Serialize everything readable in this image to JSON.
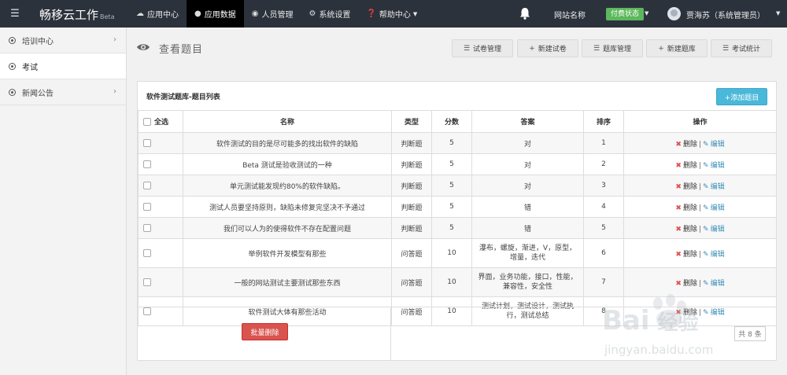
{
  "navbar": {
    "brand": "畅移云工作",
    "brand_suffix": "Beta",
    "items": [
      {
        "label": "应用中心",
        "icon": "cloud-icon"
      },
      {
        "label": "应用数据",
        "icon": "users-icon",
        "active": true
      },
      {
        "label": "人员管理",
        "icon": "dashboard-icon"
      },
      {
        "label": "系统设置",
        "icon": "gears-icon"
      },
      {
        "label": "帮助中心",
        "icon": "question-icon",
        "has_dropdown": true
      }
    ],
    "site_name": "网站名称",
    "pay_status": "付费状态",
    "user": "贾海苏（系统管理员）"
  },
  "sidebar": {
    "items": [
      {
        "label": "培训中心",
        "has_arrow": true
      },
      {
        "label": "考试",
        "active": true
      },
      {
        "label": "新闻公告",
        "has_arrow": true
      }
    ]
  },
  "page": {
    "title": "查看题目",
    "buttons": [
      "试卷管理",
      "新建试卷",
      "题库管理",
      "新建题库",
      "考试统计"
    ]
  },
  "panel": {
    "title": "软件测试题库-题目列表",
    "add_button": "+添加题目",
    "columns": {
      "select_all": "全选",
      "name": "名称",
      "type": "类型",
      "score": "分数",
      "answer": "答案",
      "order": "排序",
      "action": "操作"
    },
    "rows": [
      {
        "name": "软件测试的目的是尽可能多的找出软件的缺陷",
        "type": "判断题",
        "score": "5",
        "answer": "对",
        "order": "1"
      },
      {
        "name": "Beta 测试是验收测试的一种",
        "type": "判断题",
        "score": "5",
        "answer": "对",
        "order": "2"
      },
      {
        "name": "单元测试能发现约80%的软件缺陷。",
        "type": "判断题",
        "score": "5",
        "answer": "对",
        "order": "3"
      },
      {
        "name": "测试人员要坚持原则，缺陷未修复完坚决不予通过",
        "type": "判断题",
        "score": "5",
        "answer": "错",
        "order": "4"
      },
      {
        "name": "我们可以人为的使得软件不存在配置问题",
        "type": "判断题",
        "score": "5",
        "answer": "错",
        "order": "5"
      },
      {
        "name": "举例软件开发模型有那些",
        "type": "问答题",
        "score": "10",
        "answer_lines": [
          "瀑布，螺旋，渐进，V，原型，",
          "增量，迭代"
        ],
        "order": "6"
      },
      {
        "name": "一般的网站测试主要测试那些东西",
        "type": "问答题",
        "score": "10",
        "answer_lines": [
          "界面，业务功能，接口，性能，",
          "兼容性，安全性"
        ],
        "order": "7"
      },
      {
        "name": "软件测试大体有那些活动",
        "type": "问答题",
        "score": "10",
        "answer_lines": [
          "测试计划，测试设计，测试执",
          "行，测试总结"
        ],
        "order": "8"
      }
    ],
    "delete_label": "删除",
    "edit_label": "编辑",
    "separator": "|",
    "batch_delete": "批量删除",
    "total": "共 8 条"
  },
  "watermark": {
    "text1": "Bai",
    "text2": "经验",
    "url": "jingyan.baidu.com"
  }
}
